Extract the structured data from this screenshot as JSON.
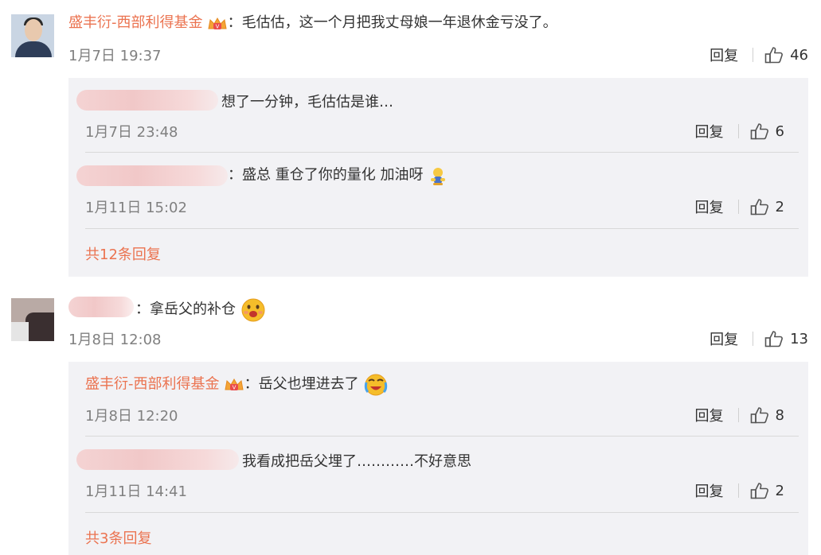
{
  "comments": [
    {
      "username": "盛丰衍-西部利得基金",
      "sep": "：",
      "text": "毛估估，这一个月把我丈母娘一年退休金亏没了。",
      "time": "1月7日 19:37",
      "reply_label": "回复",
      "likes": "46",
      "replies": [
        {
          "text": "想了一分钟，毛估估是谁…",
          "time": "1月7日 23:48",
          "reply_label": "回复",
          "likes": "6"
        },
        {
          "sep": "：",
          "text": "盛总 重仓了你的量化 加油呀",
          "time": "1月11日 15:02",
          "reply_label": "回复",
          "likes": "2"
        }
      ],
      "more_label": "共12条回复"
    },
    {
      "sep": "：",
      "text": "拿岳父的补仓",
      "time": "1月8日 12:08",
      "reply_label": "回复",
      "likes": "13",
      "replies": [
        {
          "username": "盛丰衍-西部利得基金",
          "sep": "：",
          "text": "岳父也埋进去了",
          "time": "1月8日 12:20",
          "reply_label": "回复",
          "likes": "8"
        },
        {
          "text": "我看成把岳父埋了…………不好意思",
          "time": "1月11日 14:41",
          "reply_label": "回复",
          "likes": "2"
        }
      ],
      "more_label": "共3条回复"
    }
  ],
  "colors": {
    "username": "#eb7350",
    "reply_bg": "#f2f2f5",
    "time": "#808080"
  },
  "icons": [
    "avatar",
    "vip-crown-icon",
    "thumbs-up-icon",
    "emoji-icon"
  ]
}
